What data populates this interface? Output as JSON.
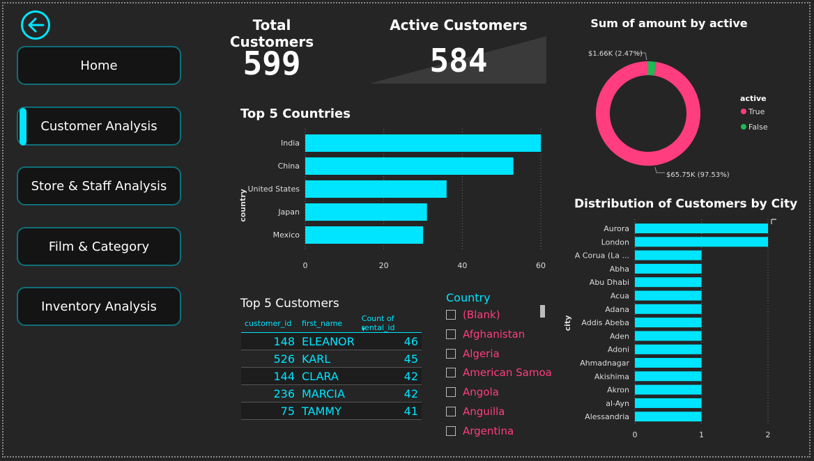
{
  "nav": {
    "home": "Home",
    "customer_analysis": "Customer Analysis",
    "store_staff": "Store & Staff Analysis",
    "film_category": "Film & Category",
    "inventory": "Inventory Analysis",
    "active_item": "Customer Analysis"
  },
  "kpis": {
    "total_title": "Total Customers",
    "total_value": "599",
    "active_title": "Active Customers",
    "active_value": "584"
  },
  "colors": {
    "accent": "#00e5ff",
    "true_color": "#ff3d7f",
    "false_color": "#1db954",
    "background": "#252525"
  },
  "countries_chart": {
    "title": "Top 5 Countries",
    "ylabel": "country"
  },
  "donut": {
    "title": "Sum of amount by active",
    "legend_title": "active",
    "false_label": "$1.66K (2.47%)",
    "true_label": "$65.75K (97.53%)"
  },
  "city_chart": {
    "title": "Distribution of Customers by City",
    "ylabel": "city"
  },
  "top_customers": {
    "title": "Top 5 Customers",
    "columns": [
      "customer_id",
      "first_name",
      "Count of rental_id"
    ],
    "rows": [
      {
        "id": "148",
        "name": "ELEANOR",
        "count": "46"
      },
      {
        "id": "526",
        "name": "KARL",
        "count": "45"
      },
      {
        "id": "144",
        "name": "CLARA",
        "count": "42"
      },
      {
        "id": "236",
        "name": "MARCIA",
        "count": "42"
      },
      {
        "id": "75",
        "name": "TAMMY",
        "count": "41"
      }
    ]
  },
  "slicer": {
    "title": "Country",
    "items": [
      "(Blank)",
      "Afghanistan",
      "Algeria",
      "American Samoa",
      "Angola",
      "Anguilla",
      "Argentina"
    ]
  },
  "chart_data": [
    {
      "type": "bar",
      "orientation": "horizontal",
      "title": "Top 5 Countries",
      "ylabel": "country",
      "xlabel": "",
      "categories": [
        "India",
        "China",
        "United States",
        "Japan",
        "Mexico"
      ],
      "values": [
        60,
        53,
        36,
        31,
        30
      ],
      "xlim": [
        0,
        60
      ],
      "xticks": [
        0,
        20,
        40,
        60
      ]
    },
    {
      "type": "pie",
      "title": "Sum of amount by active",
      "legend_title": "active",
      "categories": [
        "True",
        "False"
      ],
      "values": [
        65.75,
        1.66
      ],
      "data_labels": [
        "$65.75K (97.53%)",
        "$1.66K (2.47%)"
      ]
    },
    {
      "type": "bar",
      "orientation": "horizontal",
      "title": "Distribution of Customers by City",
      "ylabel": "city",
      "xlabel": "",
      "categories": [
        "Aurora",
        "London",
        "A Corua (La ...",
        "Abha",
        "Abu Dhabi",
        "Acua",
        "Adana",
        "Addis Abeba",
        "Aden",
        "Adoni",
        "Ahmadnagar",
        "Akishima",
        "Akron",
        "al-Ayn",
        "Alessandria"
      ],
      "values": [
        2,
        2,
        1,
        1,
        1,
        1,
        1,
        1,
        1,
        1,
        1,
        1,
        1,
        1,
        1
      ],
      "xlim": [
        0,
        2
      ],
      "xticks": [
        0,
        1,
        2
      ]
    }
  ]
}
